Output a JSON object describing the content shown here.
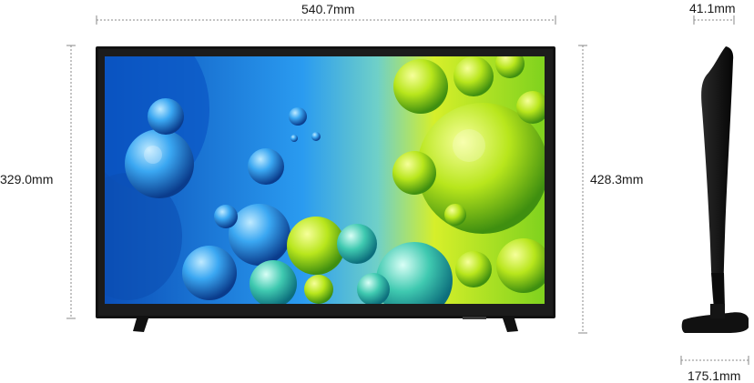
{
  "dimensions": {
    "width": "540.7mm",
    "height_screen": "329.0mm",
    "height_with_stand": "428.3mm",
    "depth": "41.1mm",
    "stand_depth": "175.1mm"
  },
  "colors": {
    "frame": "#111111",
    "dim_line": "#8a8a8a",
    "screen_blue": "#1a7fd6",
    "screen_green": "#a8e21a"
  }
}
